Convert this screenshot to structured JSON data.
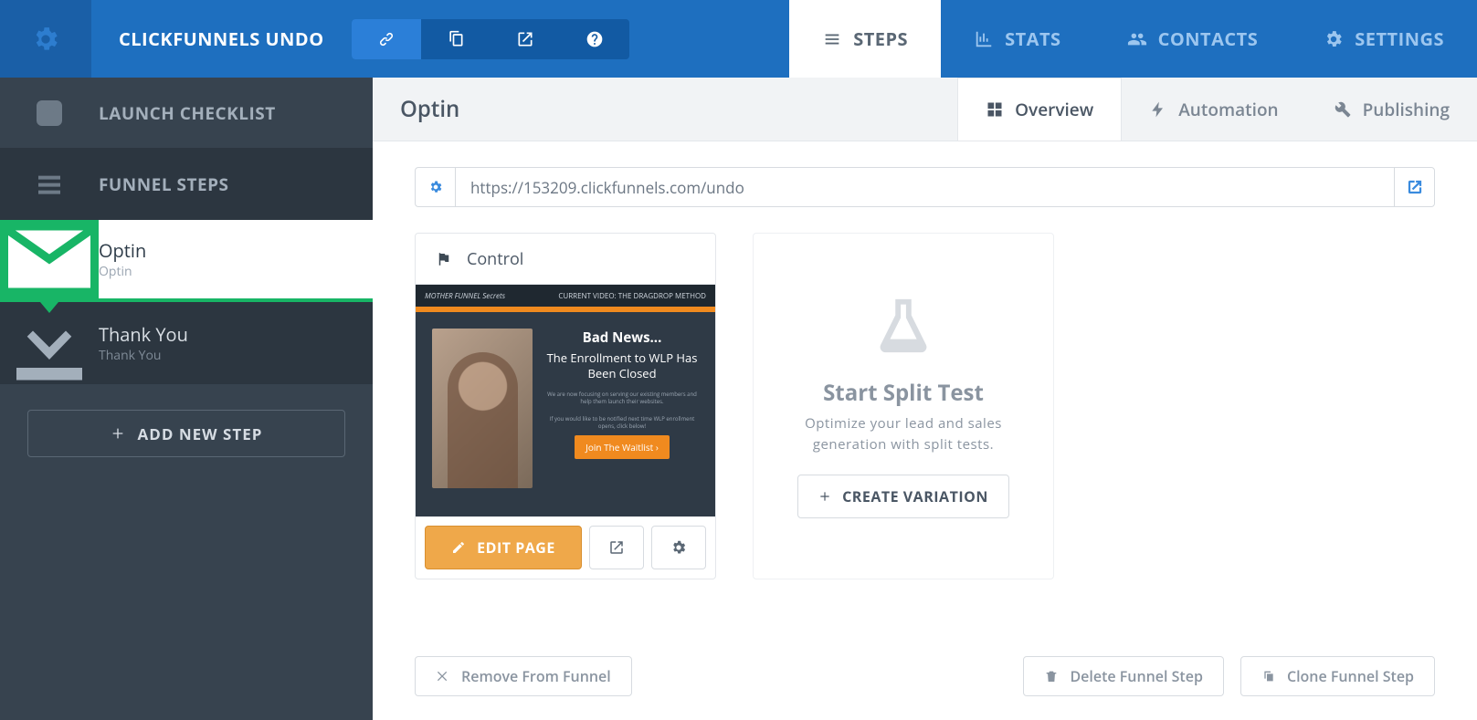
{
  "topbar": {
    "title": "CLICKFUNNELS UNDO",
    "tabs": [
      {
        "label": "STEPS",
        "active": true
      },
      {
        "label": "STATS",
        "active": false
      },
      {
        "label": "CONTACTS",
        "active": false
      },
      {
        "label": "SETTINGS",
        "active": false
      }
    ]
  },
  "sidebar": {
    "launch_checklist": "LAUNCH CHECKLIST",
    "funnel_steps": "FUNNEL STEPS",
    "steps": [
      {
        "title": "Optin",
        "subtitle": "Optin",
        "active": true
      },
      {
        "title": "Thank You",
        "subtitle": "Thank You",
        "active": false
      }
    ],
    "add_new_step": "ADD NEW STEP"
  },
  "subheader": {
    "title": "Optin",
    "tabs": [
      {
        "label": "Overview",
        "active": true
      },
      {
        "label": "Automation",
        "active": false
      },
      {
        "label": "Publishing",
        "active": false
      }
    ]
  },
  "url_bar": {
    "value": "https://153209.clickfunnels.com/undo"
  },
  "control_card": {
    "label": "Control",
    "thumbnail": {
      "top_logo": "MOTHER FUNNEL Secrets",
      "top_right": "CURRENT VIDEO: THE DRAGDROP METHOD",
      "headline": "Bad News...",
      "subline": "The Enrollment to WLP Has Been Closed",
      "small1": "We are now focusing on serving our existing members and help them launch their websites.",
      "small2": "If you would like to be notified next time WLP enrollment opens, click below!",
      "cta": "Join The Waitlist ›"
    },
    "edit_label": "EDIT PAGE"
  },
  "split_test": {
    "title": "Start Split Test",
    "description": "Optimize your lead and sales generation with split tests.",
    "button": "CREATE VARIATION"
  },
  "footer": {
    "remove": "Remove From Funnel",
    "delete": "Delete Funnel Step",
    "clone": "Clone Funnel Step"
  }
}
